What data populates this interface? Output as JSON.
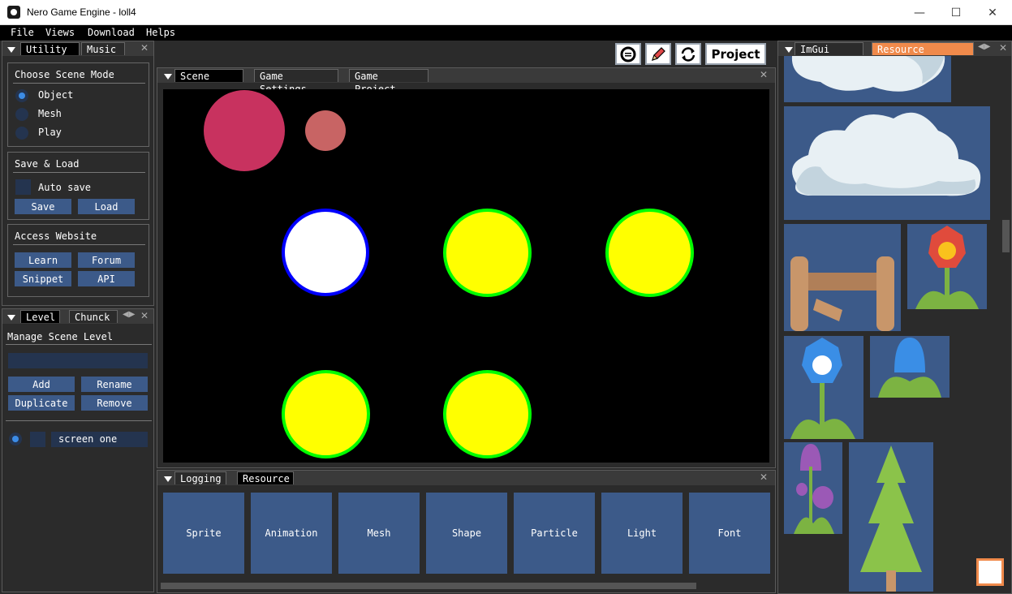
{
  "window": {
    "title": "Nero Game Engine - loll4",
    "minimize": "—",
    "maximize": "☐",
    "close": "✕"
  },
  "menu": [
    "File",
    "Views",
    "Download",
    "Helps"
  ],
  "toolbar": {
    "project_label": "Project"
  },
  "utility_panel": {
    "tabs": [
      "Utility",
      "Music"
    ],
    "scene_mode": {
      "title": "Choose Scene Mode",
      "options": [
        "Object",
        "Mesh",
        "Play"
      ],
      "selected": "Object"
    },
    "save_load": {
      "title": "Save & Load",
      "auto_save_label": "Auto save",
      "save_label": "Save",
      "load_label": "Load"
    },
    "access_website": {
      "title": "Access Website",
      "buttons": [
        "Learn",
        "Forum",
        "Snippet",
        "API"
      ]
    }
  },
  "level_panel": {
    "tabs": [
      "Level",
      "Chunck"
    ],
    "title": "Manage Scene Level",
    "buttons": [
      "Add",
      "Rename",
      "Duplicate",
      "Remove"
    ],
    "levels": [
      {
        "name": "screen one"
      }
    ]
  },
  "scene_panel": {
    "tabs": [
      "Scene",
      "Game Settings",
      "Game Project"
    ]
  },
  "scene_objects": [
    {
      "shape": "circle",
      "fill": "#c8325f",
      "outline": "none"
    },
    {
      "shape": "circle",
      "fill": "#c86464",
      "outline": "none"
    },
    {
      "shape": "circle",
      "fill": "#ffffff",
      "outline": "#0000ff"
    },
    {
      "shape": "circle",
      "fill": "#ffff00",
      "outline": "#00ff00"
    },
    {
      "shape": "circle",
      "fill": "#ffff00",
      "outline": "#00ff00"
    },
    {
      "shape": "circle",
      "fill": "#ffff00",
      "outline": "#00ff00"
    },
    {
      "shape": "circle",
      "fill": "#ffff00",
      "outline": "#00ff00"
    }
  ],
  "bottom_panel": {
    "tabs": [
      "Logging",
      "Resource"
    ],
    "resources": [
      "Sprite",
      "Animation",
      "Mesh",
      "Shape",
      "Particle",
      "Light",
      "Font"
    ]
  },
  "right_panel": {
    "tabs": [
      "ImGui Demo",
      "Resource Browser"
    ],
    "assets": [
      "cloud-small",
      "cloud-large",
      "fence",
      "red-flower",
      "blue-flower",
      "blue-bud",
      "purple-tulips",
      "pine-tree"
    ]
  },
  "colors": {
    "button": "#3c5a89",
    "frame": "#24344f",
    "accent_tab": "#f08a4b",
    "background": "#2b2b2b"
  }
}
